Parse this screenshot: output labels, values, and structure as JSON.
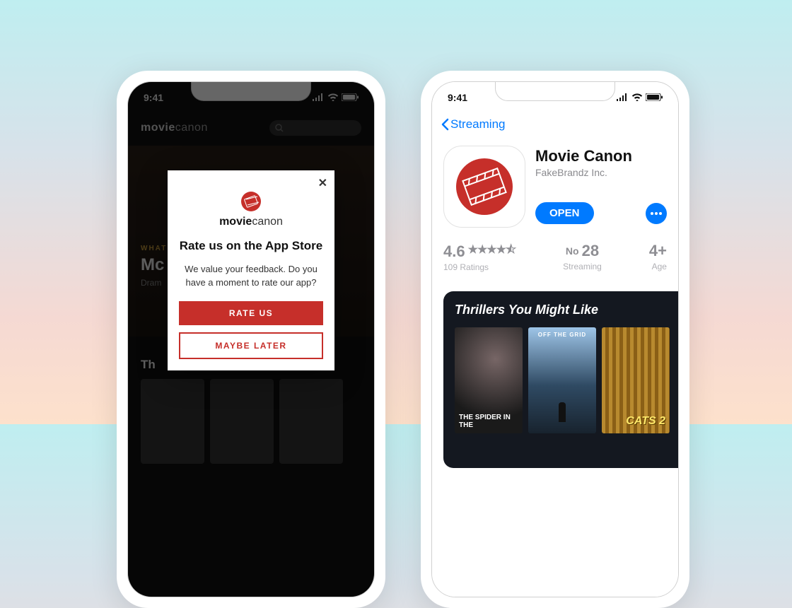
{
  "status_time": "9:41",
  "left": {
    "brand_bold": "movie",
    "brand_light": "canon",
    "hero": {
      "eyebrow": "WHAT",
      "title": "Mc",
      "sub": "Dram"
    },
    "section": "Th",
    "modal": {
      "brand_bold": "movie",
      "brand_light": "canon",
      "title": "Rate us on the App Store",
      "body": "We value your feedback. Do you have a moment to rate our app?",
      "primary": "RATE US",
      "secondary": "MAYBE LATER",
      "close": "✕"
    }
  },
  "right": {
    "back": "Streaming",
    "app_name": "Movie Canon",
    "publisher": "FakeBrandz Inc.",
    "open": "OPEN",
    "stats": {
      "rating": "4.6",
      "ratings_label": "109 Ratings",
      "rank": "28",
      "rank_prefix": "No",
      "category": "Streaming",
      "age": "4+",
      "age_label": "Age"
    },
    "card": {
      "title": "Thrillers You Might Like",
      "thumbs": [
        {
          "label": "THE SPIDER IN THE"
        },
        {
          "label": "OFF THE GRID"
        },
        {
          "label": "CATS 2"
        }
      ]
    }
  }
}
